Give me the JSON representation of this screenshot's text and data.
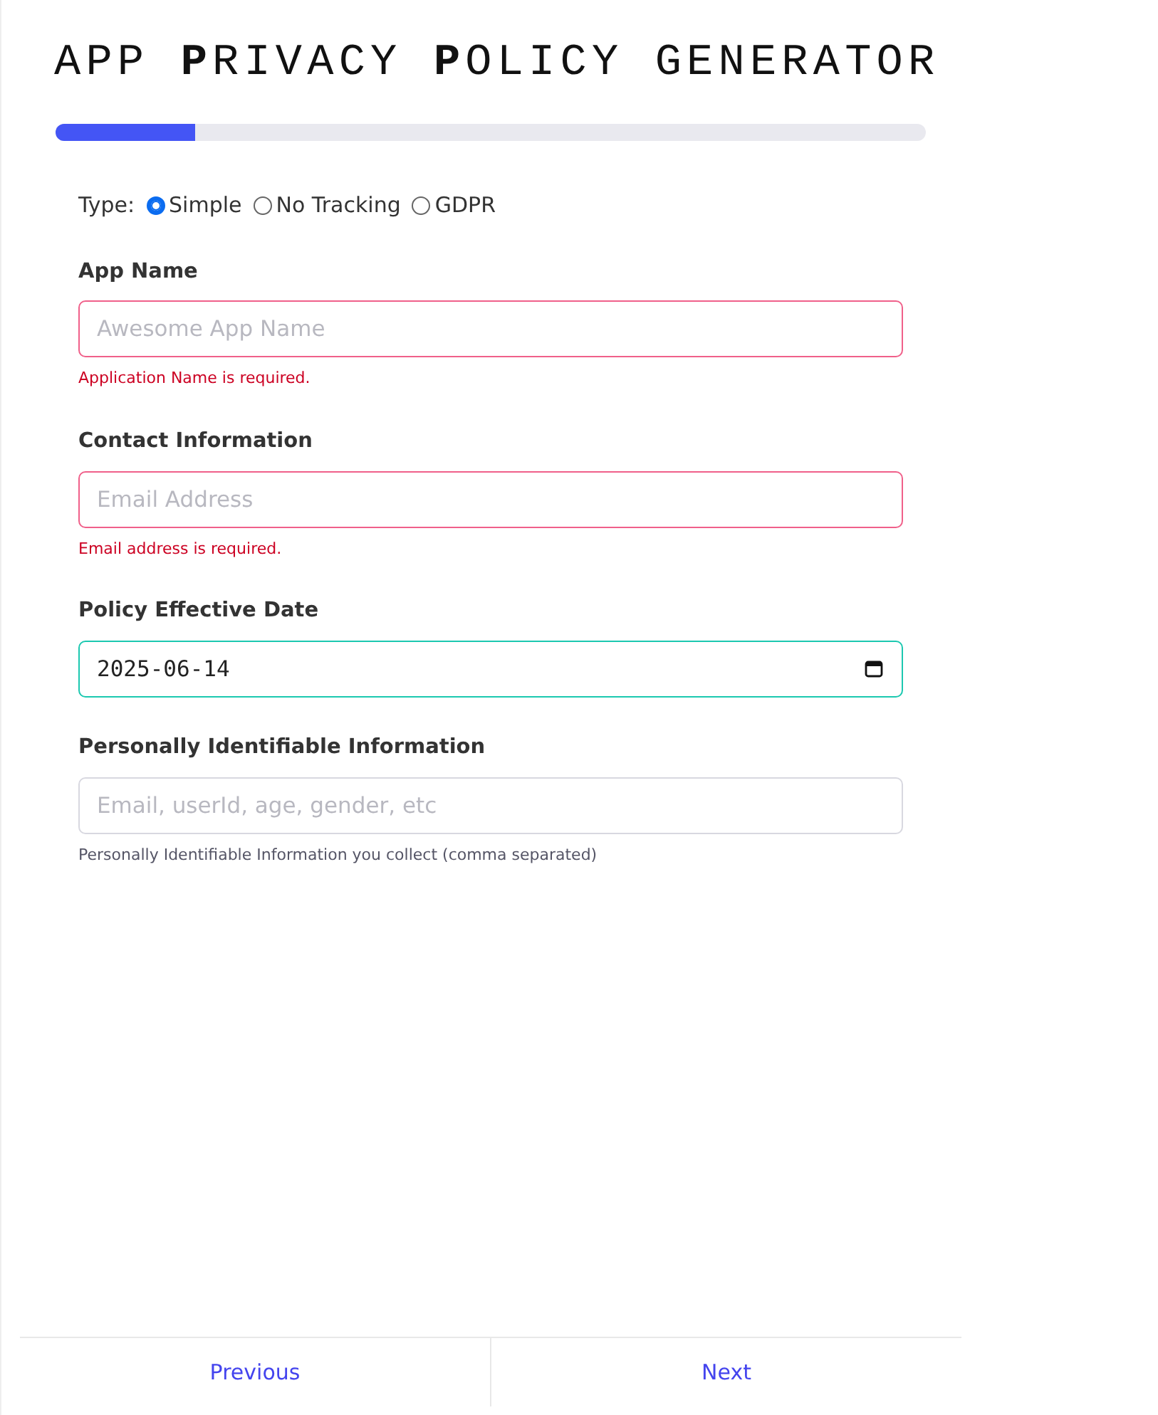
{
  "title": "APP **P**RIVACY **P**OLICY GENERATOR",
  "progress": {
    "level": 0.16
  },
  "type_selector": {
    "label": "Type:",
    "options": [
      {
        "label": "Simple",
        "selected": true
      },
      {
        "label": "No Tracking",
        "selected": false
      },
      {
        "label": "GDPR",
        "selected": false
      }
    ]
  },
  "fields": [
    {
      "kind": "text",
      "label": "App Name",
      "placeholder": "Awesome App Name",
      "invalid": true,
      "valid": false,
      "message": "Application Name is required."
    },
    {
      "kind": "text",
      "label": "Contact Information",
      "placeholder": "Email Address",
      "invalid": true,
      "valid": false,
      "message": "Email address is required."
    },
    {
      "kind": "date",
      "label": "Policy Effective Date",
      "value": "2025-06-14",
      "invalid": false,
      "valid": true
    },
    {
      "kind": "text",
      "label": "Personally Identifiable Information",
      "placeholder": "Email, userId, age, gender, etc",
      "invalid": false,
      "valid": false,
      "message": "Personally Identifiable Information you collect (comma separated)"
    }
  ],
  "footer": {
    "buttons": [
      "Previous",
      "Next"
    ]
  }
}
